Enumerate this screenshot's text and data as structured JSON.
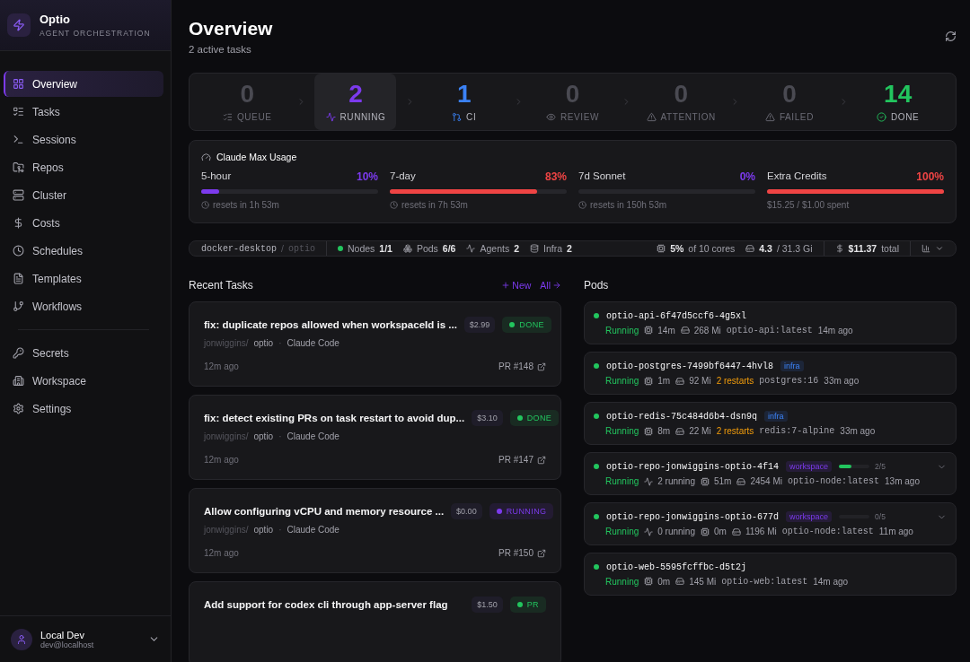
{
  "brand": {
    "name": "Optio",
    "tagline": "AGENT ORCHESTRATION"
  },
  "nav": {
    "primary": [
      {
        "label": "Overview",
        "selected": true
      },
      {
        "label": "Tasks",
        "selected": false
      },
      {
        "label": "Sessions",
        "selected": false
      },
      {
        "label": "Repos",
        "selected": false
      },
      {
        "label": "Cluster",
        "selected": false
      },
      {
        "label": "Costs",
        "selected": false
      },
      {
        "label": "Schedules",
        "selected": false
      },
      {
        "label": "Templates",
        "selected": false
      },
      {
        "label": "Workflows",
        "selected": false
      }
    ],
    "secondary": [
      {
        "label": "Secrets",
        "selected": false
      },
      {
        "label": "Workspace",
        "selected": false
      },
      {
        "label": "Settings",
        "selected": false
      }
    ]
  },
  "user": {
    "name": "Local Dev",
    "email": "dev@localhost"
  },
  "header": {
    "title": "Overview",
    "subtitle": "2 active tasks"
  },
  "pipeline": [
    {
      "kind": "queue",
      "count": "0",
      "label": "QUEUE",
      "selected": false
    },
    {
      "kind": "running",
      "count": "2",
      "label": "RUNNING",
      "selected": true
    },
    {
      "kind": "ci",
      "count": "1",
      "label": "CI",
      "selected": false
    },
    {
      "kind": "review",
      "count": "0",
      "label": "REVIEW",
      "selected": false
    },
    {
      "kind": "attention",
      "count": "0",
      "label": "ATTENTION",
      "selected": false
    },
    {
      "kind": "failed",
      "count": "0",
      "label": "FAILED",
      "selected": false
    },
    {
      "kind": "done",
      "count": "14",
      "label": "DONE",
      "selected": false
    }
  ],
  "usage": {
    "title": "Claude Max Usage",
    "meters": [
      {
        "label": "5-hour",
        "percent": "10%",
        "level": 0.1,
        "color": "#7c3aed",
        "note": "resets in 1h 53m",
        "kind": "reset"
      },
      {
        "label": "7-day",
        "percent": "83%",
        "level": 0.83,
        "color": "#ef4444",
        "note": "resets in 7h 53m",
        "kind": "reset"
      },
      {
        "label": "7d Sonnet",
        "percent": "0%",
        "level": 0,
        "color": "#7c3aed",
        "note": "resets in 150h 53m",
        "kind": "reset"
      },
      {
        "label": "Extra Credits",
        "percent": "100%",
        "level": 1,
        "color": "#ef4444",
        "note": "$15.25 / $1.00 spent",
        "kind": "spent"
      }
    ]
  },
  "cluster": {
    "context": "docker-desktop",
    "separator": "/",
    "namespace": "optio",
    "stats": [
      {
        "kind": "nodes",
        "label": "Nodes",
        "value": "1/1"
      },
      {
        "kind": "pods",
        "label": "Pods",
        "value": "6/6"
      },
      {
        "kind": "agents",
        "label": "Agents",
        "value": "2"
      },
      {
        "kind": "infra",
        "label": "Infra",
        "value": "2"
      }
    ],
    "cpu": {
      "value": "5%",
      "detail": "of 10 cores"
    },
    "memory": {
      "value": "4.3",
      "detail": "/ 31.3 Gi"
    },
    "cost": {
      "value": "$11.37",
      "detail": "total"
    }
  },
  "recent_tasks": {
    "title": "Recent Tasks",
    "new_label": "New",
    "all_label": "All",
    "tasks": [
      {
        "title": "fix: duplicate repos allowed when workspaceId is ...",
        "cost": "$2.99",
        "status": {
          "kind": "done",
          "label": "DONE"
        },
        "owner": "jonwiggins/",
        "repo": "optio",
        "separator": "·",
        "agent": "Claude Code",
        "time": "12m ago",
        "pr": "PR #148"
      },
      {
        "title": "fix: detect existing PRs on task restart to avoid dup...",
        "cost": "$3.10",
        "status": {
          "kind": "done",
          "label": "DONE"
        },
        "owner": "jonwiggins/",
        "repo": "optio",
        "separator": "·",
        "agent": "Claude Code",
        "time": "12m ago",
        "pr": "PR #147"
      },
      {
        "title": "Allow configuring vCPU and memory resource ...",
        "cost": "$0.00",
        "status": {
          "kind": "running",
          "label": "RUNNING"
        },
        "owner": "jonwiggins/",
        "repo": "optio",
        "separator": "·",
        "agent": "Claude Code",
        "time": "12m ago",
        "pr": "PR #150"
      },
      {
        "title": "Add support for codex cli through app-server flag",
        "cost": "$1.50",
        "status": {
          "kind": "done",
          "label": "PR"
        }
      }
    ]
  },
  "pods": {
    "title": "Pods",
    "items": [
      {
        "name": "optio-api-6f47d5ccf6-4g5xl",
        "stats": [
          {
            "kind": "status",
            "text": "Running"
          },
          {
            "kind": "cpu",
            "text": "14m"
          },
          {
            "kind": "mem",
            "text": "268 Mi"
          },
          {
            "kind": "image",
            "text": "optio-api:latest"
          },
          {
            "kind": "age",
            "text": "14m ago"
          }
        ]
      },
      {
        "name": "optio-postgres-7499bf6447-4hvl8",
        "tag": {
          "kind": "infra",
          "label": "infra"
        },
        "stats": [
          {
            "kind": "status",
            "text": "Running"
          },
          {
            "kind": "cpu",
            "text": "1m"
          },
          {
            "kind": "mem",
            "text": "92 Mi"
          },
          {
            "kind": "restarts",
            "text": "2 restarts"
          },
          {
            "kind": "image",
            "text": "postgres:16"
          },
          {
            "kind": "age",
            "text": "33m ago"
          }
        ]
      },
      {
        "name": "optio-redis-75c484d6b4-dsn9q",
        "tag": {
          "kind": "infra",
          "label": "infra"
        },
        "stats": [
          {
            "kind": "status",
            "text": "Running"
          },
          {
            "kind": "cpu",
            "text": "8m"
          },
          {
            "kind": "mem",
            "text": "22 Mi"
          },
          {
            "kind": "restarts",
            "text": "2 restarts"
          },
          {
            "kind": "image",
            "text": "redis:7-alpine"
          },
          {
            "kind": "age",
            "text": "33m ago"
          }
        ]
      },
      {
        "name": "optio-repo-jonwiggins-optio-4f14",
        "tag": {
          "kind": "workspace",
          "label": "workspace"
        },
        "slots": {
          "level": 0.4,
          "text": "2/5"
        },
        "expandable": true,
        "stats": [
          {
            "kind": "status",
            "text": "Running"
          },
          {
            "kind": "running",
            "text": "2 running"
          },
          {
            "kind": "cpu",
            "text": "51m"
          },
          {
            "kind": "mem",
            "text": "2454 Mi"
          },
          {
            "kind": "image",
            "text": "optio-node:latest"
          },
          {
            "kind": "age",
            "text": "13m ago"
          }
        ]
      },
      {
        "name": "optio-repo-jonwiggins-optio-677d",
        "tag": {
          "kind": "workspace",
          "label": "workspace"
        },
        "slots": {
          "level": 0,
          "text": "0/5"
        },
        "expandable": true,
        "stats": [
          {
            "kind": "status",
            "text": "Running"
          },
          {
            "kind": "running",
            "text": "0 running"
          },
          {
            "kind": "cpu",
            "text": "0m"
          },
          {
            "kind": "mem",
            "text": "1196 Mi"
          },
          {
            "kind": "image",
            "text": "optio-node:latest"
          },
          {
            "kind": "age",
            "text": "11m ago"
          }
        ]
      },
      {
        "name": "optio-web-5595fcffbc-d5t2j",
        "stats": [
          {
            "kind": "status",
            "text": "Running"
          },
          {
            "kind": "cpu",
            "text": "0m"
          },
          {
            "kind": "mem",
            "text": "145 Mi"
          },
          {
            "kind": "image",
            "text": "optio-web:latest"
          },
          {
            "kind": "age",
            "text": "14m ago"
          }
        ]
      }
    ]
  }
}
